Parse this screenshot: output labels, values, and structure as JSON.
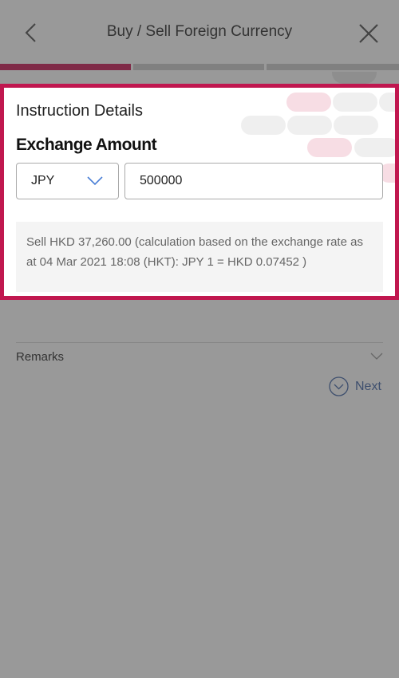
{
  "header": {
    "title": "Buy / Sell Foreign Currency",
    "back_icon": "chevron-left-icon",
    "close_icon": "close-icon"
  },
  "progress": {
    "steps": 3,
    "current": 1,
    "active_color": "#7f2a47"
  },
  "highlight_color": "#c0174f",
  "instruction": {
    "section_title": "Instruction Details",
    "field_label": "Exchange Amount",
    "currency": "JPY",
    "amount": "500000",
    "info": "Sell HKD 37,260.00 (calculation based on the exchange rate as at 04 Mar 2021 18:08 (HKT): JPY 1 = HKD 0.07452 )"
  },
  "remarks": {
    "label": "Remarks"
  },
  "next": {
    "label": "Next"
  }
}
